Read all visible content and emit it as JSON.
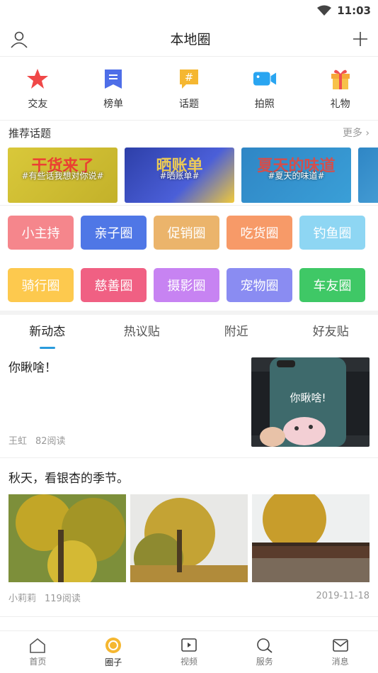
{
  "status": {
    "time": "11:03"
  },
  "header": {
    "title": "本地圈"
  },
  "quick": [
    {
      "label": "交友",
      "icon": "star-icon",
      "color": "#f04848"
    },
    {
      "label": "榜单",
      "icon": "list-icon",
      "color": "#4e6ee8"
    },
    {
      "label": "话题",
      "icon": "hashtag-icon",
      "color": "#f5b731"
    },
    {
      "label": "拍照",
      "icon": "camera-icon",
      "color": "#29a5f1"
    },
    {
      "label": "礼物",
      "icon": "gift-icon",
      "color": "#f6a837"
    }
  ],
  "recommend": {
    "title": "推荐话题",
    "more": "更多",
    "topics": [
      {
        "label": "#有些话我想对你说#",
        "art": "干货来了"
      },
      {
        "label": "#晒账单#",
        "art": "晒账单"
      },
      {
        "label": "#夏天的味道#",
        "art": "夏天的味道"
      }
    ]
  },
  "tags": [
    {
      "label": "小主持",
      "color": "#f5868c"
    },
    {
      "label": "亲子圈",
      "color": "#4f77e6"
    },
    {
      "label": "促销圈",
      "color": "#ebb46b"
    },
    {
      "label": "吃货圈",
      "color": "#f79a68"
    },
    {
      "label": "钓鱼圈",
      "color": "#8ed6f3"
    },
    {
      "label": "骑行圈",
      "color": "#fdc94e"
    },
    {
      "label": "慈善圈",
      "color": "#f06083"
    },
    {
      "label": "摄影圈",
      "color": "#c783f2"
    },
    {
      "label": "宠物圈",
      "color": "#8a8cf2"
    },
    {
      "label": "车友圈",
      "color": "#3fc866"
    }
  ],
  "tabs": [
    "新动态",
    "热议贴",
    "附近",
    "好友贴"
  ],
  "posts": [
    {
      "title": "你瞅啥！",
      "author": "王虹",
      "reads": "82阅读"
    },
    {
      "title": "秋天，看银杏的季节。",
      "author": "小莉莉",
      "reads": "119阅读",
      "date": "2019-11-18"
    }
  ],
  "nav": [
    "首页",
    "圈子",
    "视频",
    "服务",
    "消息"
  ]
}
